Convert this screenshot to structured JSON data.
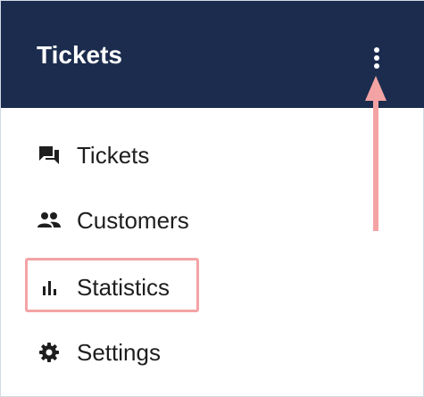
{
  "appbar": {
    "title": "Tickets",
    "more_icon": "more-vertical-icon"
  },
  "menu": {
    "items": [
      {
        "label": "Tickets",
        "icon": "forum-icon"
      },
      {
        "label": "Customers",
        "icon": "people-icon"
      },
      {
        "label": "Statistics",
        "icon": "bar-chart-icon"
      },
      {
        "label": "Settings",
        "icon": "gear-icon"
      }
    ]
  },
  "annotation": {
    "highlighted_item": "Statistics",
    "highlight_color": "#f4a3a4",
    "arrow_target": "more-vertical-icon"
  },
  "colors": {
    "appbar_background": "#1b2c4e",
    "appbar_text": "#ffffff",
    "item_text": "#1e1e1e",
    "icon": "#1e1e1e"
  }
}
